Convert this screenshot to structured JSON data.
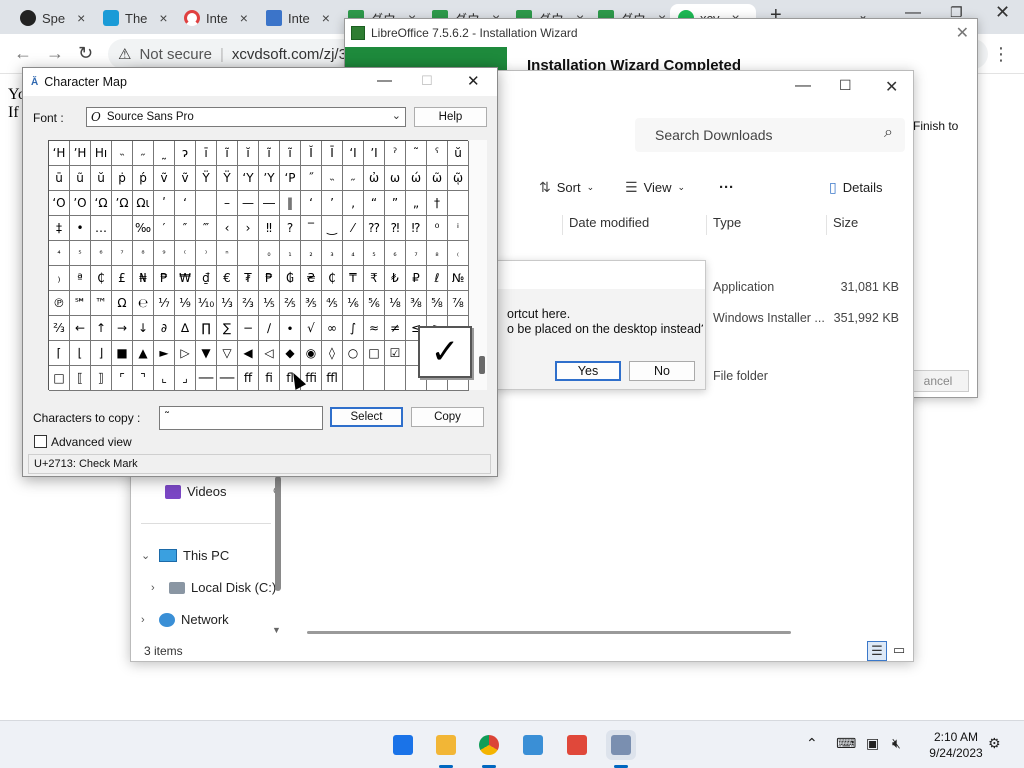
{
  "browser": {
    "tabs": [
      {
        "label": "Spe",
        "color": "#222222"
      },
      {
        "label": "The",
        "color": "#1a9bd7"
      },
      {
        "label": "Inte",
        "color": "#e04040"
      },
      {
        "label": "Inte",
        "color": "#3b74c9"
      },
      {
        "label": "ダウ",
        "color": "#2e9a4b"
      },
      {
        "label": "ダウ",
        "color": "#2e9a4b"
      },
      {
        "label": "ダウ",
        "color": "#2e9a4b"
      },
      {
        "label": "ダウ",
        "color": "#2e9a4b"
      },
      {
        "label": "xcv",
        "color": "#1db954"
      }
    ],
    "security": "Not secure",
    "url": "xcvdsoft.com/zj/36/",
    "page_text": [
      "Yo",
      "If"
    ]
  },
  "lo_wizard": {
    "title": "LibreOffice 7.5.6.2 - Installation Wizard",
    "heading": "Installation Wizard Completed",
    "finish_text": "Finish to",
    "cancel": "ancel"
  },
  "explorer": {
    "search_placeholder": "Search Downloads",
    "toolbar": {
      "sort": "Sort",
      "view": "View",
      "more": "···",
      "details": "Details"
    },
    "columns": [
      "Date modified",
      "Type",
      "Size"
    ],
    "rows": [
      {
        "type": "Application",
        "size": "31,081 KB"
      },
      {
        "type": "Windows Installer ...",
        "size": "351,992 KB"
      },
      {
        "type": "File folder",
        "size": ""
      }
    ],
    "nav": {
      "videos": "Videos",
      "this_pc": "This PC",
      "local_disk": "Local Disk (C:)",
      "network": "Network"
    },
    "status": "3 items"
  },
  "shortcut_dialog": {
    "line1": "ortcut here.",
    "line2": "o be placed on the desktop instead?",
    "yes": "Yes",
    "no": "No"
  },
  "charmap": {
    "title": "Character Map",
    "font_label": "Font :",
    "font_value": "Source Sans Pro",
    "help": "Help",
    "copy_label": "Characters to copy :",
    "copy_value": "˜",
    "select": "Select",
    "copy": "Copy",
    "advanced": "Advanced view",
    "status": "U+2713: Check Mark",
    "zoomed_char": "✓",
    "grid": [
      [
        "ʻH",
        "ʼH",
        "Hı",
        "˵",
        "˶",
        "˷",
        "ɂ",
        "ī",
        "ĩ",
        "ĭ",
        "ĩ",
        "ĩ",
        "Ĭ",
        "Ī",
        "ʻI",
        "ʼI",
        "ˀ",
        "˜",
        "ˁ",
        "ŭ"
      ],
      [
        "ū",
        "ũ",
        "ŭ",
        "ṗ",
        "ṕ",
        "ṽ",
        "ṽ",
        "Ÿ",
        "Ÿ",
        "ʻY",
        "ʼY",
        "ʻP",
        "˝",
        "˵",
        "˶",
        "ὠ",
        "ω",
        "ώ",
        "ῶ",
        "ῷ"
      ],
      [
        "ʻO",
        "ʼO",
        "ʻΩ",
        "ʼΩ",
        "Ωι",
        "ʹ",
        "ʻ",
        "",
        "–",
        "—",
        "―",
        "‖",
        "‘",
        "’",
        "‚",
        "“",
        "”",
        "„",
        "†",
        ""
      ],
      [
        "‡",
        "•",
        "…",
        "",
        "‰",
        "′",
        "″",
        "‴",
        "‹",
        "›",
        "‼",
        "?",
        "‾",
        "‿",
        "⁄",
        "⁇",
        "⁈",
        "⁉",
        "⁰",
        "ⁱ"
      ],
      [
        "⁴",
        "⁵",
        "⁶",
        "⁷",
        "⁸",
        "⁹",
        "⁽",
        "⁾",
        "ⁿ",
        "",
        "₀",
        "₁",
        "₂",
        "₃",
        "₄",
        "₅",
        "₆",
        "₇",
        "₈",
        "₍"
      ],
      [
        "₎",
        "ª",
        "₵",
        "£",
        "₦",
        "₱",
        "₩",
        "₫",
        "€",
        "₮",
        "₱",
        "₲",
        "₴",
        "₵",
        "₸",
        "₹",
        "₺",
        "₽",
        "ℓ",
        "№"
      ],
      [
        "℗",
        "℠",
        "™",
        "Ω",
        "℮",
        "⅐",
        "⅑",
        "⅒",
        "⅓",
        "⅔",
        "⅕",
        "⅖",
        "⅗",
        "⅘",
        "⅙",
        "⅚",
        "⅛",
        "⅜",
        "⅝",
        "⅞"
      ],
      [
        "⅔",
        "←",
        "↑",
        "→",
        "↓",
        "∂",
        "∆",
        "∏",
        "∑",
        "−",
        "∕",
        "∙",
        "√",
        "∞",
        "∫",
        "≈",
        "≠",
        "≤",
        "≥",
        ""
      ],
      [
        "⌈",
        "⌊",
        "⌋",
        "■",
        "▲",
        "►",
        "▷",
        "▼",
        "▽",
        "◀",
        "◁",
        "◆",
        "◉",
        "◊",
        "○",
        "□",
        "☑",
        "",
        "",
        ""
      ],
      [
        "□",
        "⟦",
        "⟧",
        "⌜",
        "⌝",
        "⌞",
        "⌟",
        "──",
        "──",
        "ff",
        "fi",
        "fl",
        "ffi",
        "ffl",
        "",
        "",
        "",
        "",
        "",
        ""
      ]
    ]
  },
  "taskbar": {
    "clock_time": "2:10 AM",
    "clock_date": "9/24/2023",
    "apps": [
      {
        "name": "start",
        "color": "#1a73e8"
      },
      {
        "name": "file-explorer",
        "color": "#f2b636"
      },
      {
        "name": "chrome",
        "color": "#db4437"
      },
      {
        "name": "remote-desktop",
        "color": "#3a8fd6"
      },
      {
        "name": "store-app",
        "color": "#e0483a"
      },
      {
        "name": "character-map",
        "color": "#7a8fb0"
      }
    ]
  }
}
